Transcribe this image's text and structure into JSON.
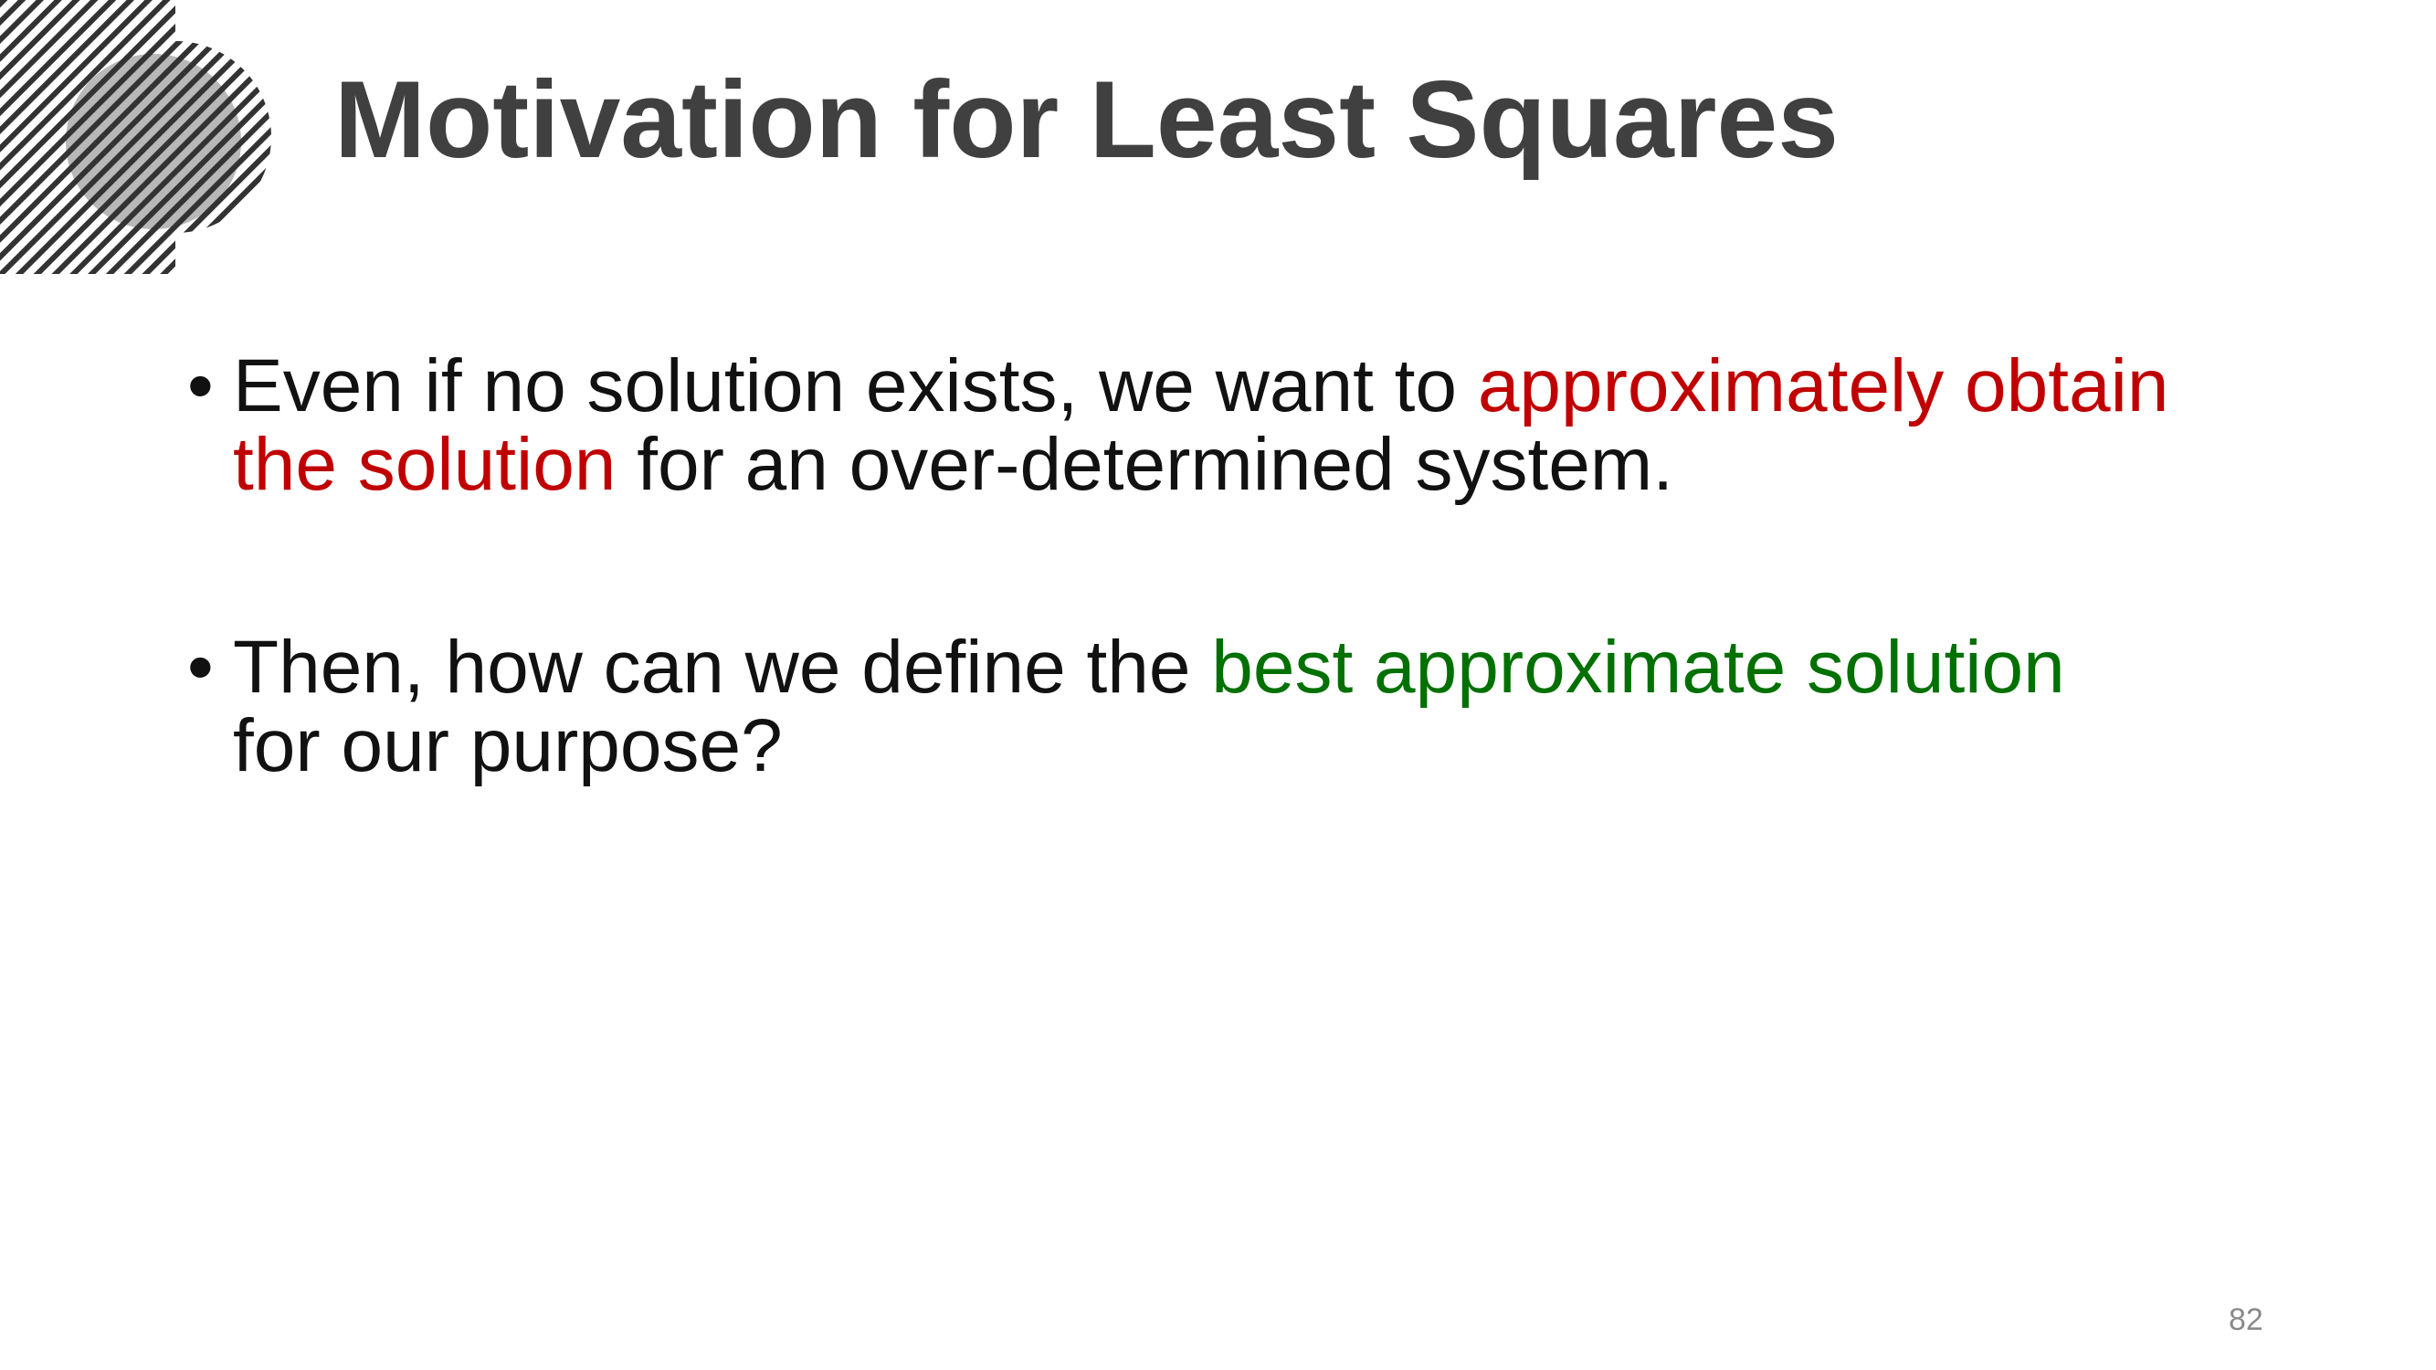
{
  "slide": {
    "title": "Motivation for Least Squares",
    "bullet_glyph": "•",
    "bullets": [
      {
        "line1_text": "Even if no solution exists, we want to ",
        "line1_highlight": "approximately obtain",
        "line2_highlight": "the solution",
        "line2_text": " for an over-determined system."
      },
      {
        "line1_text": "Then, how can we define the ",
        "line1_highlight": "best approximate solution",
        "line2_text": "for our purpose?"
      }
    ],
    "page_number": "82"
  },
  "colors": {
    "title": "#404040",
    "body_text": "#111111",
    "highlight_red": "#c00000",
    "highlight_green": "#007000",
    "page_number": "#8a8a8a",
    "decoration_stripes": "#333333"
  },
  "icons": {
    "decoration": "striped-circles-decoration"
  }
}
